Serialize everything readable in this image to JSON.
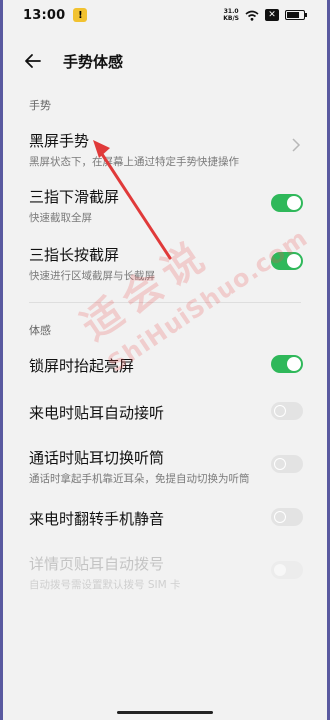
{
  "status_bar": {
    "time": "13:00",
    "speed_value": "31.0",
    "speed_unit": "KB/S",
    "x_badge": "✕",
    "notif_icon": "notification-icon",
    "battery_level_pct": 85
  },
  "header": {
    "title": "手势体感",
    "back_icon": "back-arrow-icon"
  },
  "sections": {
    "gestures": {
      "label": "手势",
      "items": [
        {
          "label": "黑屏手势",
          "sub": "黑屏状态下，在屏幕上通过特定手势快捷操作",
          "control": "chevron"
        },
        {
          "label": "三指下滑截屏",
          "sub": "快速截取全屏",
          "control": "toggle",
          "on": true
        },
        {
          "label": "三指长按截屏",
          "sub": "快速进行区域截屏与长截屏",
          "control": "toggle",
          "on": true
        }
      ]
    },
    "motion": {
      "label": "体感",
      "items": [
        {
          "label": "锁屏时抬起亮屏",
          "control": "toggle",
          "on": true
        },
        {
          "label": "来电时贴耳自动接听",
          "control": "toggle",
          "on": false
        },
        {
          "label": "通话时贴耳切换听筒",
          "sub": "通话时拿起手机靠近耳朵，免提自动切换为听筒",
          "control": "toggle",
          "on": false
        },
        {
          "label": "来电时翻转手机静音",
          "control": "toggle",
          "on": false
        },
        {
          "label": "详情页贴耳自动拨号",
          "sub": "自动拨号需设置默认拨号 SIM 卡",
          "control": "toggle",
          "on": false,
          "disabled": true
        }
      ]
    }
  },
  "watermark": {
    "cn": "适会说",
    "en": "ShiHuiShuo.com"
  },
  "colors": {
    "toggle_on": "#2fb85a",
    "annotation_arrow": "#e03a3a",
    "watermark": "#eb5050"
  }
}
